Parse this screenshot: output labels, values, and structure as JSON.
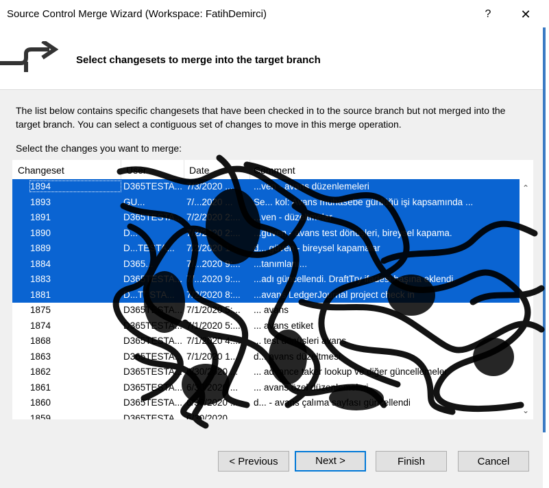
{
  "window": {
    "title": "Source Control Merge Wizard (Workspace: FatihDemirci)",
    "help_label": "?",
    "close_label": "✕"
  },
  "header": {
    "title": "Select changesets to merge into the target branch",
    "icon": "merge-arrow-icon"
  },
  "description": "The list below contains specific changesets that have been checked in to the source branch but not merged into the target branch. You can select a contiguous set of changes to move in this merge operation.",
  "select_label": "Select the changes you want to merge:",
  "list": {
    "columns": [
      "Changeset",
      "User",
      "Date",
      "Comment"
    ],
    "rows": [
      {
        "id": "1894",
        "user": "D365TESTA...",
        "date": "7/3/2020 ...",
        "comment": "...ven - avans düzenlemeleri",
        "selected": true
      },
      {
        "id": "1893",
        "user": "GU...",
        "date": "7/...2020 ...",
        "comment": "Se... kol: Avans muhasebe günlüğü işi kapsamında ...",
        "selected": true
      },
      {
        "id": "1891",
        "user": "D365TESTA...",
        "date": "7/2/2020 2:...",
        "comment": "...ven - düzeltmeler",
        "selected": true
      },
      {
        "id": "1890",
        "user": "D...",
        "date": "7/2/2020 2:...",
        "comment": "...güven - avans test dönüşleri, bireysel kapama.",
        "selected": true
      },
      {
        "id": "1889",
        "user": "D...TESTA...",
        "date": "7/2/2020 1:...",
        "comment": "d... güven - bireysel kapamalar",
        "selected": true
      },
      {
        "id": "1884",
        "user": "D365...",
        "date": "7/...2020 9:...",
        "comment": "...tanımlanı...",
        "selected": true
      },
      {
        "id": "1883",
        "user": "D365TESTA...",
        "date": "7/...2020 9:...",
        "comment": "...adı güncellendi. DraftTry ifadesi başına eklendi.",
        "selected": true
      },
      {
        "id": "1881",
        "user": "D...TESTA...",
        "date": "7/2/2020 8:...",
        "comment": "...avans LedgerJournal project check in",
        "selected": true
      },
      {
        "id": "1875",
        "user": "D365TESTA...",
        "date": "7/1/2020 5:...",
        "comment": "... avans",
        "selected": false
      },
      {
        "id": "1874",
        "user": "D365TESTA...",
        "date": "7/1/2020 5:...",
        "comment": "... avans etiket",
        "selected": false
      },
      {
        "id": "1868",
        "user": "D365TESTA...",
        "date": "7/1/2020 4:...",
        "comment": "... test dönüşleri avans",
        "selected": false
      },
      {
        "id": "1863",
        "user": "D365TESTA...",
        "date": "7/1/2020 1...",
        "comment": "d... avans düzeltmesi",
        "selected": false
      },
      {
        "id": "1862",
        "user": "D365TESTA...",
        "date": "6/30/2020 ...",
        "comment": "... advance taker lookup ve diğer güncellemeler",
        "selected": false
      },
      {
        "id": "1861",
        "user": "D365TESTA...",
        "date": "6/30/2020 ...",
        "comment": "... avans özel düzenlemeleri",
        "selected": false
      },
      {
        "id": "1860",
        "user": "D365TESTA...",
        "date": "6/30/2020 ...",
        "comment": "d... - avans çalıma sayfası güncellendi",
        "selected": false
      },
      {
        "id": "1859",
        "user": "D365TESTA...",
        "date": "6/30/2020 ...",
        "comment": "...",
        "selected": false
      }
    ]
  },
  "buttons": {
    "previous": "< Previous",
    "next": "Next >",
    "finish": "Finish",
    "cancel": "Cancel"
  },
  "colors": {
    "selection": "#0a64d2",
    "accent": "#0078d7",
    "scribble": "#000000"
  }
}
